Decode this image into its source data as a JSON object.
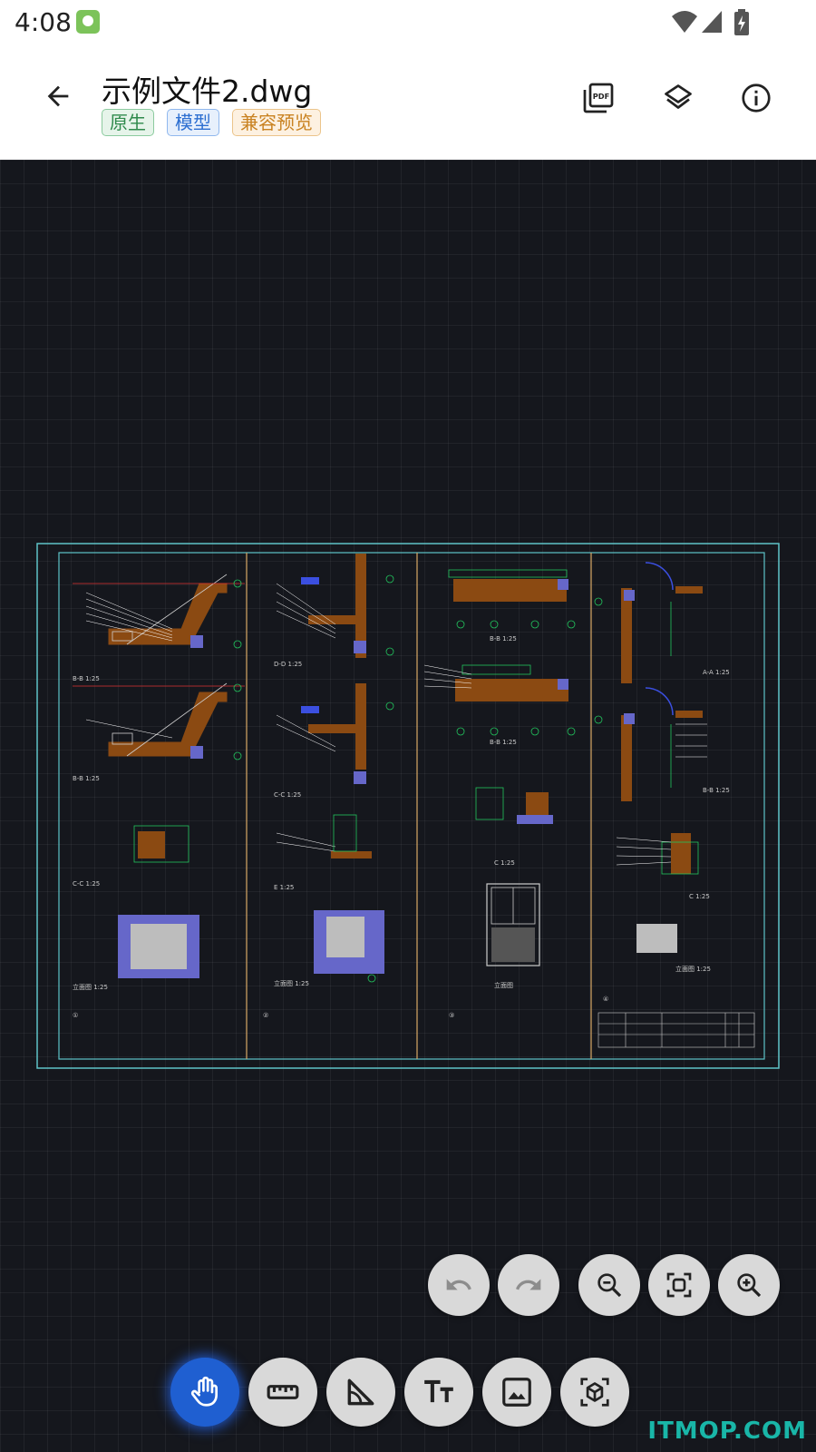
{
  "status_bar": {
    "time": "4:08"
  },
  "header": {
    "title": "示例文件2.dwg",
    "tags": [
      "原生",
      "模型",
      "兼容预览"
    ]
  },
  "icons": {
    "back": "arrow-left-icon",
    "pdf": "pdf-icon",
    "layers": "layers-icon",
    "info": "info-icon",
    "undo": "undo-icon",
    "redo": "redo-icon",
    "zoom_out": "zoom-out-icon",
    "fit": "fit-screen-icon",
    "zoom_in": "zoom-in-icon",
    "pan": "hand-icon",
    "measure": "ruler-icon",
    "angle": "angle-icon",
    "text": "text-icon",
    "image": "image-icon",
    "view3d": "cube-icon"
  },
  "colors": {
    "canvas_bg": "#15171d",
    "active_tool": "#1f5fd1",
    "frame": "#5ec4c8",
    "wall": "#8b4a12",
    "dims": "#22c55e"
  },
  "watermark": "ITMOP.COM"
}
